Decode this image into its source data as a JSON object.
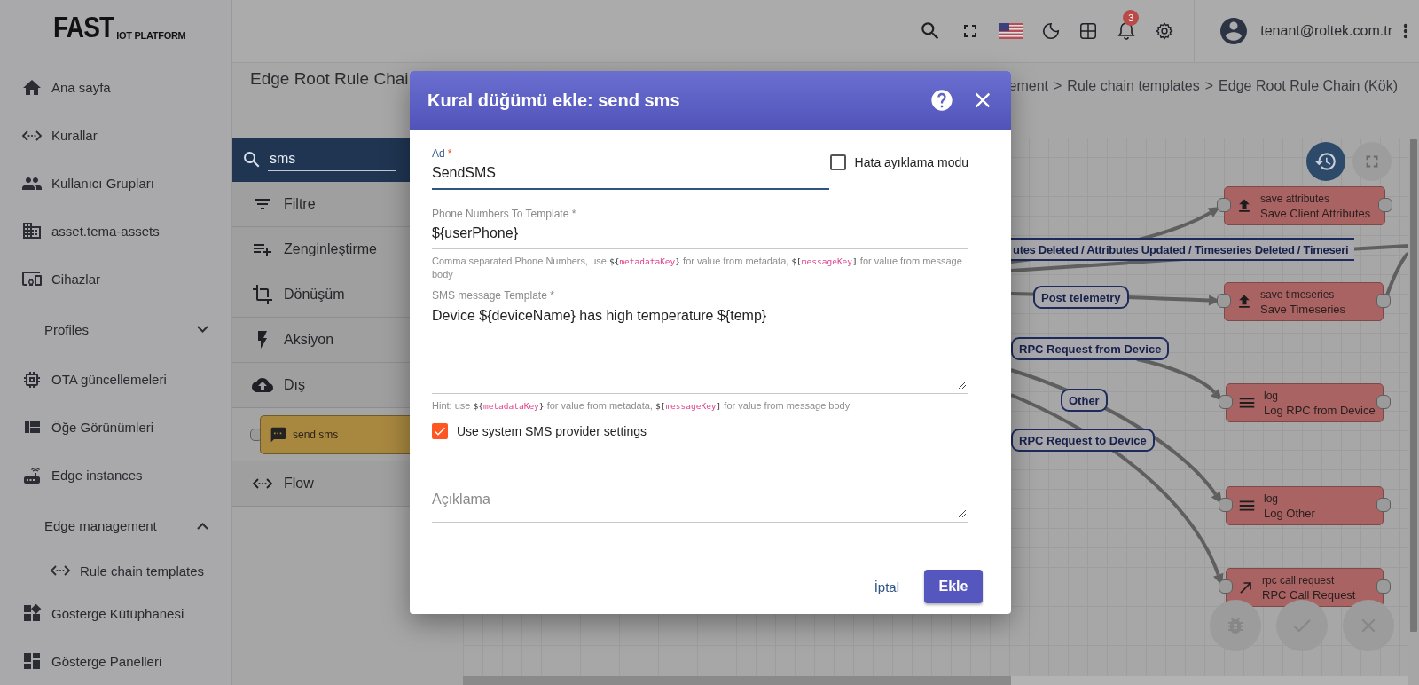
{
  "logo": {
    "main": "FAST",
    "sub": "IOT PLATFORM"
  },
  "sidebar": {
    "items": [
      {
        "kind": "link",
        "label": "Ana sayfa"
      },
      {
        "kind": "link",
        "label": "Kurallar"
      },
      {
        "kind": "link",
        "label": "Kullanıcı Grupları"
      },
      {
        "kind": "link",
        "label": "asset.tema-assets"
      },
      {
        "kind": "link",
        "label": "Cihazlar"
      },
      {
        "kind": "group",
        "label": "Profiles",
        "expanded": false
      },
      {
        "kind": "link",
        "label": "OTA güncellemeleri"
      },
      {
        "kind": "link",
        "label": "Öğe Görünümleri"
      },
      {
        "kind": "link",
        "label": "Edge instances"
      },
      {
        "kind": "group",
        "label": "Edge management",
        "expanded": true,
        "children": [
          {
            "label": "Rule chain templates"
          }
        ]
      },
      {
        "kind": "link",
        "label": "Gösterge Kütüphanesi"
      },
      {
        "kind": "link",
        "label": "Gösterge Panelleri"
      }
    ]
  },
  "header": {
    "notification_count": "3",
    "user": "tenant@roltek.com.tr"
  },
  "page": {
    "title": "Edge Root Rule Chai",
    "breadcrumb": [
      {
        "label": "ement"
      },
      {
        "separator": ">",
        "label": "Rule chain templates"
      },
      {
        "separator": ">",
        "label": "Edge Root Rule Chain (Kök)"
      }
    ]
  },
  "library": {
    "search": {
      "value": "sms"
    },
    "categories": [
      {
        "label": "Filtre"
      },
      {
        "label": "Zenginleştirme"
      },
      {
        "label": "Dönüşüm"
      },
      {
        "label": "Aksiyon"
      },
      {
        "label": "Dış",
        "nodes": [
          {
            "label": "send sms"
          }
        ]
      },
      {
        "label": "Flow"
      }
    ]
  },
  "dialog": {
    "title": "Kural düğümü ekle: send sms",
    "name_field": {
      "label": "Ad",
      "required_mark": "*",
      "value": "SendSMS"
    },
    "debug_mode": {
      "label": "Hata ayıklama modu",
      "checked": false
    },
    "phone_field": {
      "label": "Phone Numbers To Template *",
      "value": "${userPhone}",
      "hint": [
        {
          "text": "Comma separated Phone Numbers, use "
        },
        {
          "open": "${",
          "key": "metadataKey",
          "close": "}"
        },
        {
          "text": " for value from metadata, "
        },
        {
          "open": "$[",
          "key": "messageKey",
          "close": "]"
        },
        {
          "text": " for value from message body"
        }
      ]
    },
    "message_field": {
      "label": "SMS message Template *",
      "value": "Device ${deviceName} has high temperature ${temp}",
      "hint": [
        {
          "text": "Hint: use "
        },
        {
          "open": "${",
          "key": "metadataKey",
          "close": "}"
        },
        {
          "text": " for value from metadata, "
        },
        {
          "open": "$[",
          "key": "messageKey",
          "close": "]"
        },
        {
          "text": " for value from message body"
        }
      ]
    },
    "use_system_settings": {
      "label": "Use system SMS provider settings",
      "checked": true
    },
    "description_field": {
      "placeholder": "Açıklama"
    },
    "buttons": [
      {
        "kind": "text",
        "label": "İptal"
      },
      {
        "kind": "primary",
        "label": "Ekle"
      }
    ]
  },
  "canvas": {
    "nodes": [
      {
        "kind": "save",
        "type": "save attributes",
        "name": "Save Client Attributes"
      },
      {
        "kind": "save",
        "type": "save timeseries",
        "name": "Save Timeseries"
      },
      {
        "kind": "log",
        "type": "log",
        "name": "Log RPC from Device"
      },
      {
        "kind": "log",
        "type": "log",
        "name": "Log Other"
      },
      {
        "kind": "rpc",
        "type": "rpc call request",
        "name": "RPC Call Request"
      }
    ],
    "labels": [
      {
        "label": "utes Deleted / Attributes Updated / Timeseries Deleted / Timeseri"
      },
      {
        "label": "Post telemetry"
      },
      {
        "label": "RPC Request from Device"
      },
      {
        "label": "Other"
      },
      {
        "label": "RPC Request to Device"
      }
    ]
  }
}
